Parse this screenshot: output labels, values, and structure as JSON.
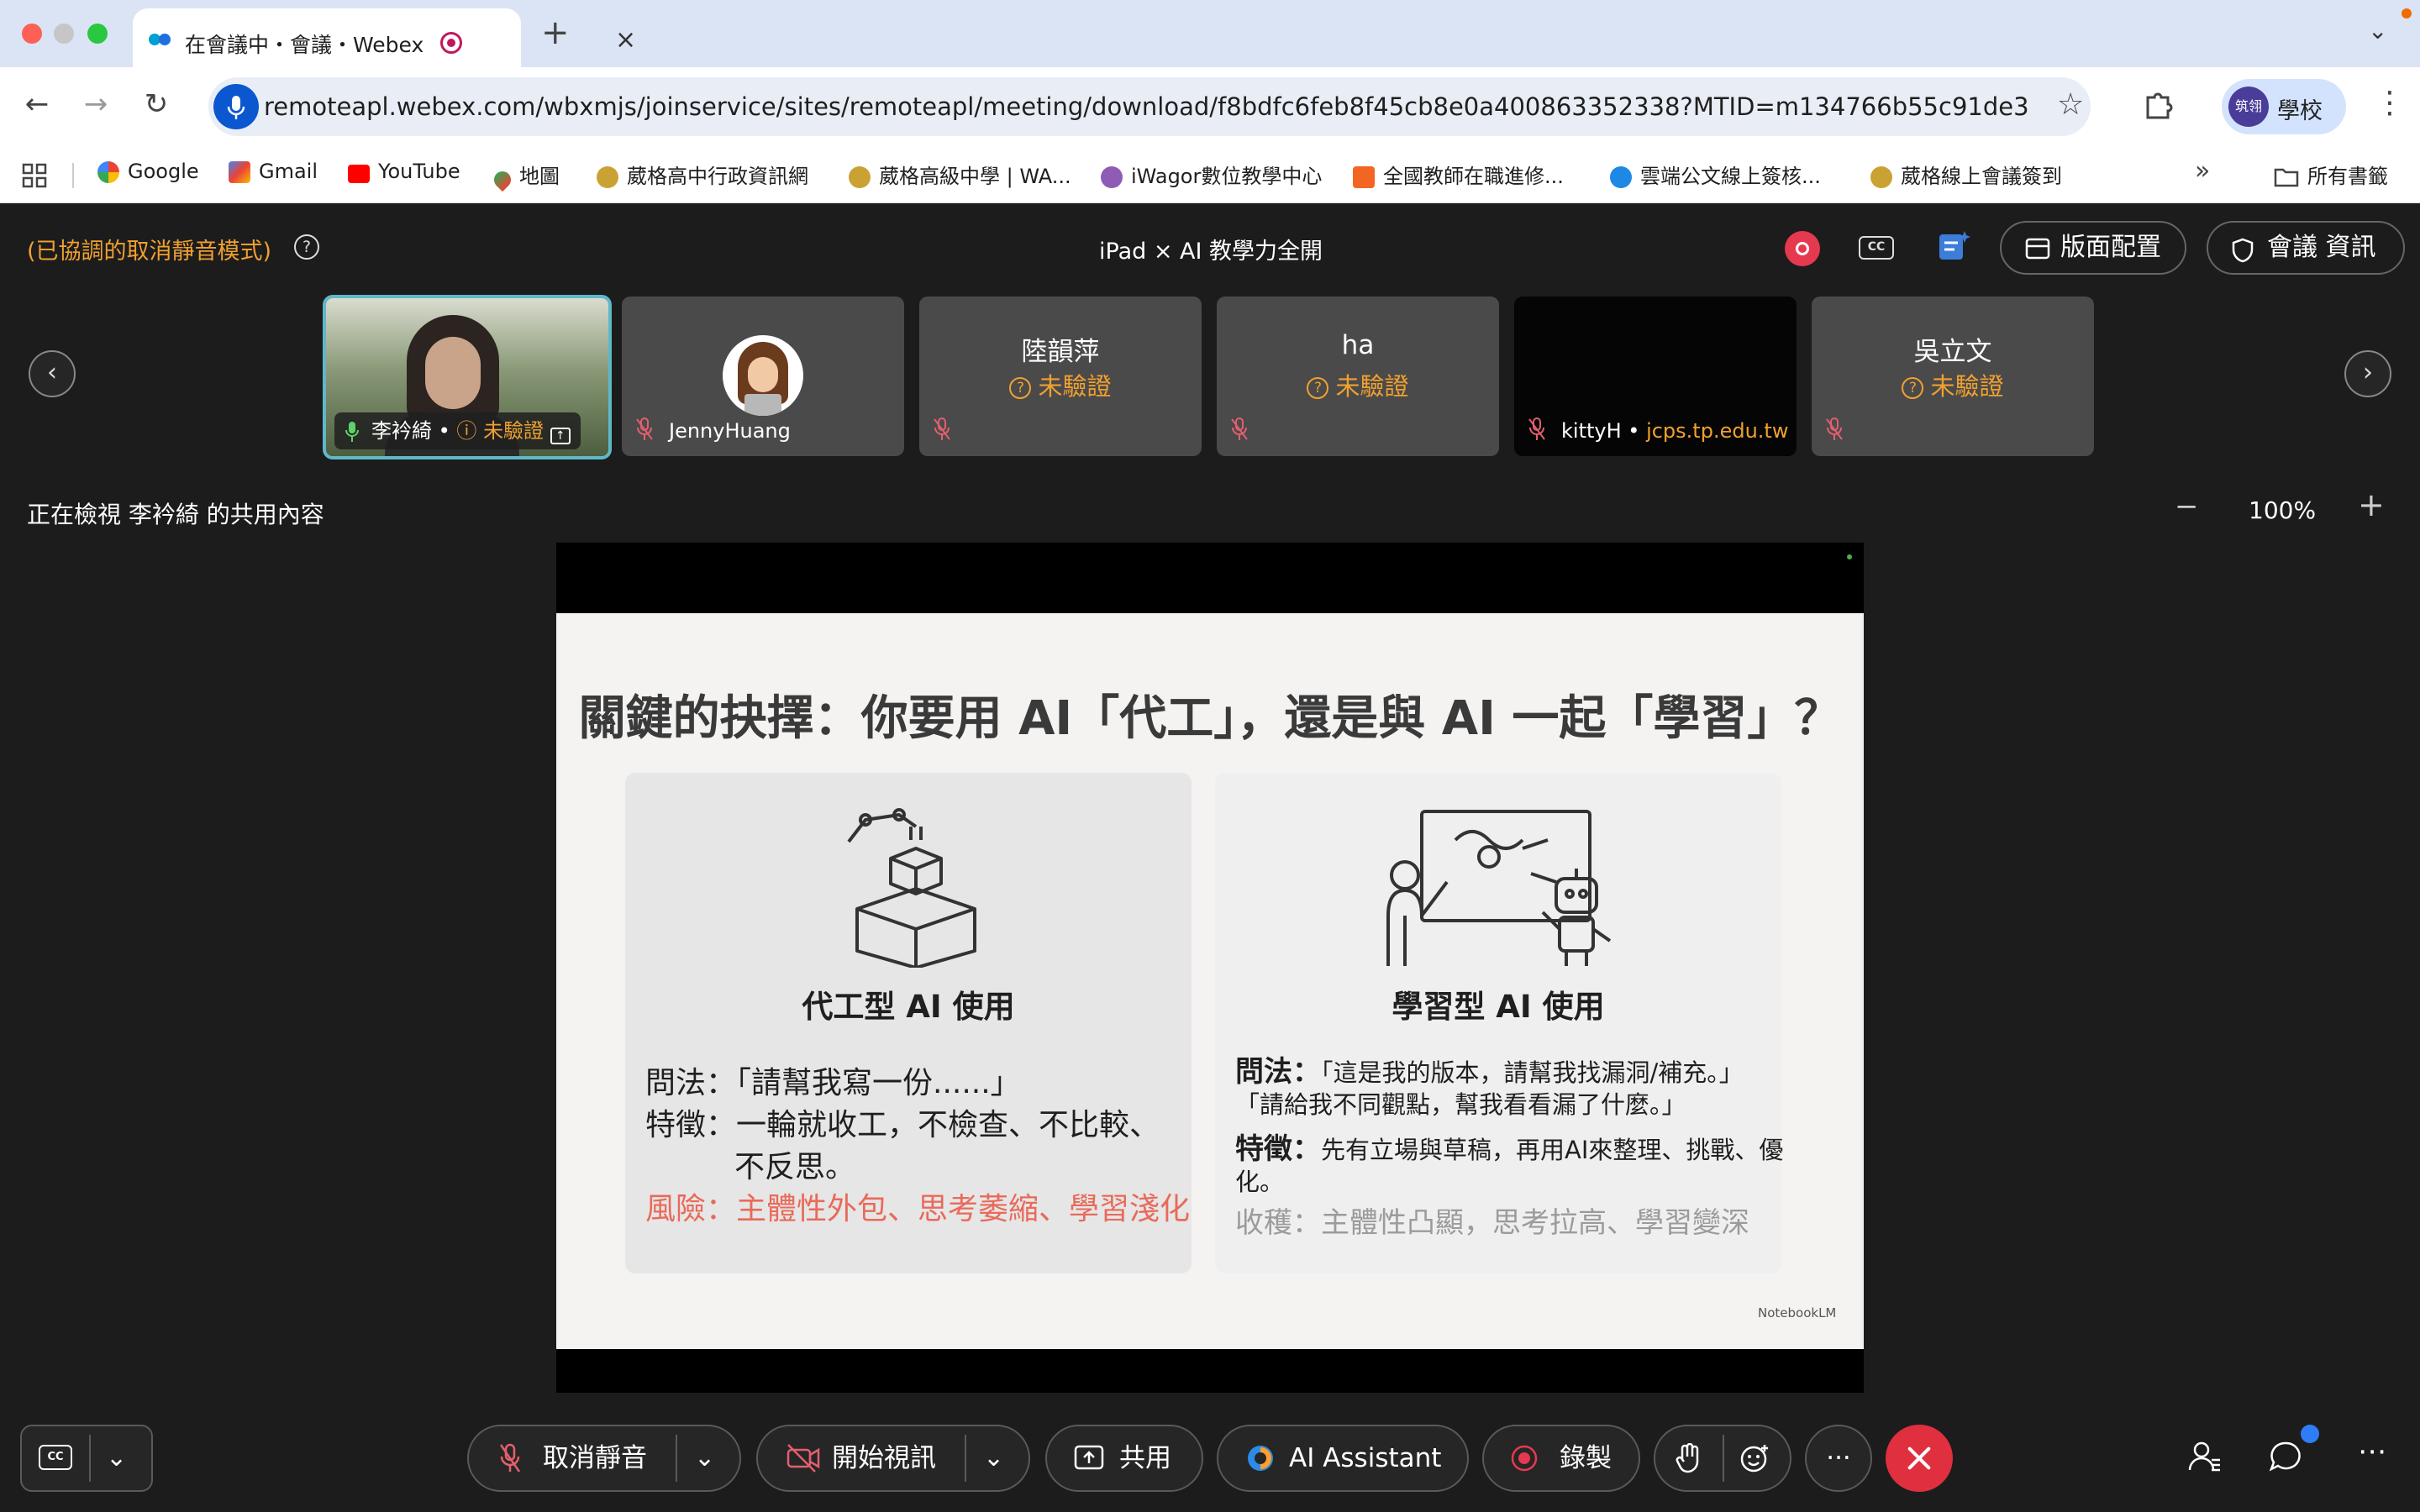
{
  "browser": {
    "tab_title": "在會議中・會議・Webex",
    "url": "remoteapl.webex.com/wbxmjs/joinservice/sites/remoteapl/meeting/download/f8bdfc6feb8f45cb8e0a400863352338?MTID=m134766b55c91de3a2c925134e...",
    "profile_badge": "筑翎",
    "profile_name": "學校",
    "bookmarks": [
      "Google",
      "Gmail",
      "YouTube",
      "地圖",
      "葳格高中行政資訊網",
      "葳格高級中學 | WA...",
      "iWagor數位教學中心",
      "全國教師在職進修...",
      "雲端公文線上簽核...",
      "葳格線上會議簽到"
    ],
    "bookmarks_all": "所有書籤"
  },
  "meeting": {
    "mute_mode": "(已協調的取消靜音模式)",
    "title": "iPad × AI 教學力全開",
    "cc_label": "CC",
    "layout_button": "版面配置",
    "info_button": "會議 資訊",
    "participants": [
      {
        "name": "李衿綺",
        "status": "未驗證"
      },
      {
        "name": "JennyHuang"
      },
      {
        "name": "陸韻萍",
        "status": "未驗證"
      },
      {
        "name": "ha",
        "status": "未驗證"
      },
      {
        "name": "kittyH",
        "domain": "jcps.tp.edu.tw"
      },
      {
        "name": "吳立文",
        "status": "未驗證"
      }
    ],
    "viewing_text": "正在檢視 李衿綺 的共用內容",
    "zoom": "100%"
  },
  "slide": {
    "title": "關鍵的抉擇：你要用 AI「代工」，還是與 AI 一起「學習」？",
    "left": {
      "heading": "代工型 AI 使用",
      "line1": "問法：「請幫我寫一份......」",
      "line2": "特徵：一輪就收工，不檢查、不比較、",
      "line3": "不反思。",
      "risk": "風險：主體性外包、思考萎縮、學習淺化"
    },
    "right": {
      "heading": "學習型 AI 使用",
      "ask_label": "問法：",
      "ask1": "「這是我的版本，請幫我找漏洞/補充。」",
      "ask2": "「請給我不同觀點，幫我看看漏了什麼。」",
      "feature_label": "特徵：",
      "feature1": "先有立場與草稿，再用AI來整理、挑戰、優",
      "feature2": "化。",
      "gain": "收穫：主體性凸顯，思考拉高、學習變深"
    },
    "watermark": "NotebookLM"
  },
  "controls": {
    "cc": "CC",
    "unmute": "取消靜音",
    "start_video": "開始視訊",
    "share": "共用",
    "ai_assistant": "AI Assistant",
    "record": "錄製",
    "more": "···"
  },
  "colors": {
    "accent_orange": "#f0a030",
    "leave_red": "#e02f3f",
    "record_red": "#e53950",
    "risk_red": "#e96a5a"
  }
}
